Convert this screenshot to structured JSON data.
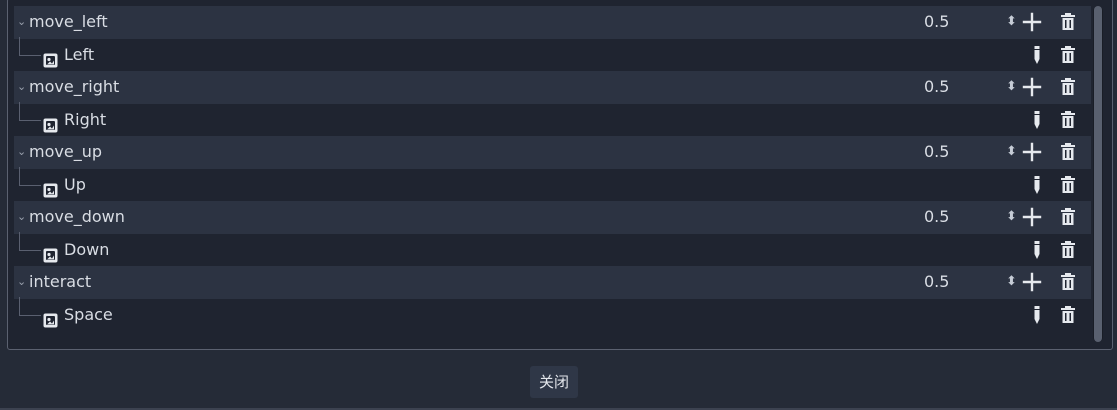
{
  "actions": [
    {
      "name": "move_left",
      "deadzone": "0.5",
      "event": "Left"
    },
    {
      "name": "move_right",
      "deadzone": "0.5",
      "event": "Right"
    },
    {
      "name": "move_up",
      "deadzone": "0.5",
      "event": "Up"
    },
    {
      "name": "move_down",
      "deadzone": "0.5",
      "event": "Down"
    },
    {
      "name": "interact",
      "deadzone": "0.5",
      "event": "Space"
    }
  ],
  "glyphs": {
    "expand": "⌄",
    "spin": "⬍"
  },
  "icons": {
    "expand": "chevron-down-icon",
    "spin": "spinner-arrows-icon",
    "add": "plus-icon",
    "edit": "pencil-icon",
    "delete": "trash-icon",
    "event_type": "joypad-icon"
  },
  "colors": {
    "panel_bg": "#1f2430",
    "action_row_bg": "#2c3342",
    "text": "#d9dde4",
    "icon": "#e6e9ee"
  },
  "footer": {
    "close_label": "关闭"
  }
}
